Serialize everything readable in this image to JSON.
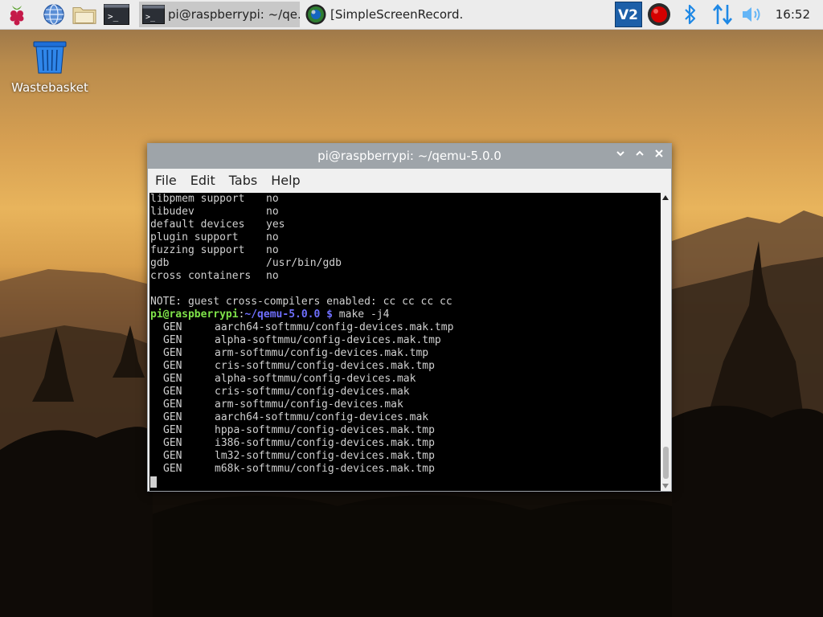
{
  "taskbar": {
    "launchers": [
      {
        "name": "raspberry-menu",
        "icon": "raspberry-icon"
      },
      {
        "name": "web-browser",
        "icon": "globe-icon"
      },
      {
        "name": "file-manager",
        "icon": "folder-icon"
      },
      {
        "name": "terminal-launcher",
        "icon": "terminal-icon"
      }
    ],
    "tasks": [
      {
        "label": "pi@raspberrypi: ~/qe...",
        "icon": "terminal-icon",
        "active": true
      },
      {
        "label": "[SimpleScreenRecord...",
        "icon": "screen-recorder-icon",
        "active": false
      }
    ],
    "tray": [
      "vnc-icon",
      "record-icon",
      "bluetooth-icon",
      "network-icon",
      "volume-icon"
    ],
    "clock": "16:52"
  },
  "desktop": {
    "wastebasket_label": "Wastebasket"
  },
  "terminal": {
    "title": "pi@raspberrypi: ~/qemu-5.0.0",
    "menu": [
      "File",
      "Edit",
      "Tabs",
      "Help"
    ],
    "config_lines": [
      [
        "libpmem support",
        "no"
      ],
      [
        "libudev",
        "no"
      ],
      [
        "default devices",
        "yes"
      ],
      [
        "plugin support",
        "no"
      ],
      [
        "fuzzing support",
        "no"
      ],
      [
        "gdb",
        "/usr/bin/gdb"
      ],
      [
        "cross containers",
        "no"
      ]
    ],
    "note": "NOTE: guest cross-compilers enabled: cc cc cc cc",
    "prompt": {
      "user": "pi@raspberrypi",
      "sep": ":",
      "path": "~/qemu-5.0.0",
      "symbol": " $",
      "command": " make -j4"
    },
    "gen_tag": "GEN",
    "gen_files": [
      "aarch64-softmmu/config-devices.mak.tmp",
      "alpha-softmmu/config-devices.mak.tmp",
      "arm-softmmu/config-devices.mak.tmp",
      "cris-softmmu/config-devices.mak.tmp",
      "alpha-softmmu/config-devices.mak",
      "cris-softmmu/config-devices.mak",
      "arm-softmmu/config-devices.mak",
      "aarch64-softmmu/config-devices.mak",
      "hppa-softmmu/config-devices.mak.tmp",
      "i386-softmmu/config-devices.mak.tmp",
      "lm32-softmmu/config-devices.mak.tmp",
      "m68k-softmmu/config-devices.mak.tmp"
    ]
  }
}
